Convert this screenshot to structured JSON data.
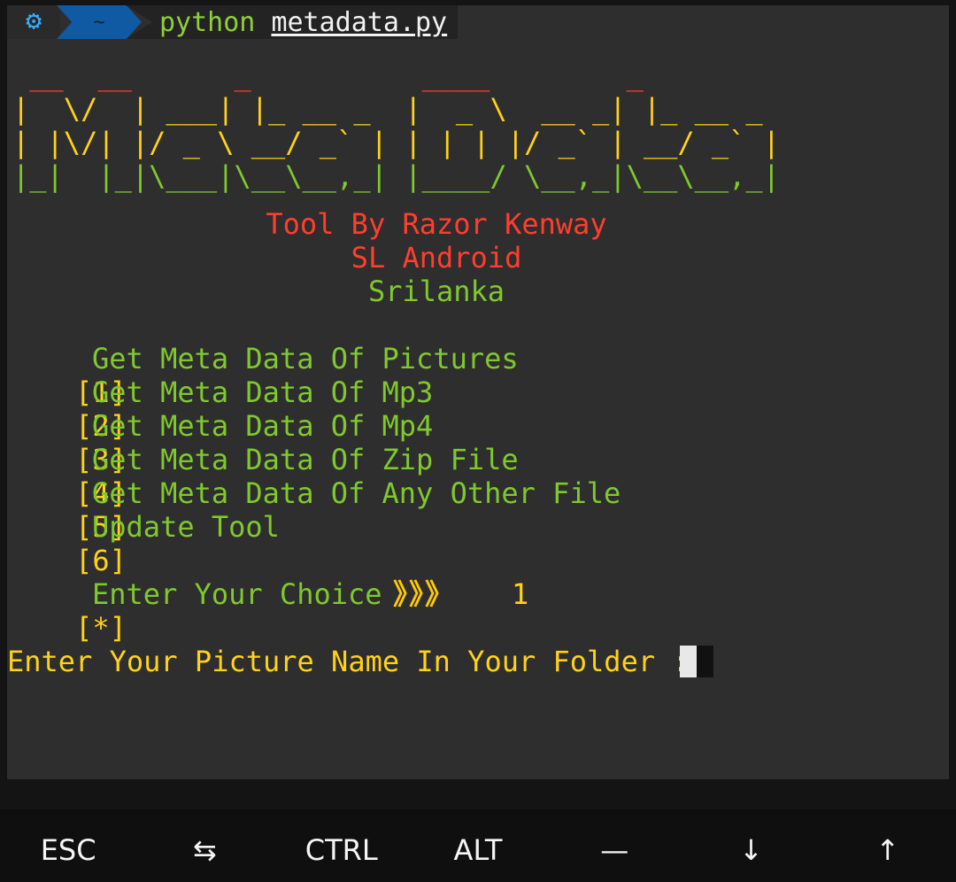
{
  "prompt": {
    "icon": "gear-icon",
    "directory": "~",
    "command": "python",
    "argument": "metadata.py"
  },
  "banner": {
    "ascii_text": "Meta Data",
    "colors": {
      "top": "#ff3e2e",
      "middle": "#ffd21a",
      "bottom": "#7fc92d"
    }
  },
  "credits": {
    "line1": "Tool By Razor Kenway",
    "line2": "SL Android",
    "line3": "Srilanka"
  },
  "menu": [
    {
      "num": "[1]",
      "label": "Get Meta Data Of Pictures"
    },
    {
      "num": "[2]",
      "label": "Get Meta Data Of Mp3"
    },
    {
      "num": "[3]",
      "label": "Get Meta Data Of Mp4"
    },
    {
      "num": "[4]",
      "label": "Get Meta Data Of Zip File"
    },
    {
      "num": "[5]",
      "label": "Get Meta Data Of Any Other File"
    },
    {
      "num": "[6]",
      "label": "Update Tool"
    }
  ],
  "choice": {
    "marker": "[*]",
    "label": "Enter Your Choice",
    "arrows": "》》》",
    "value": "1"
  },
  "input_prompt": "Enter Your Picture Name In Your Folder :",
  "extra_keys": [
    {
      "label": "ESC",
      "name": "esc-key"
    },
    {
      "label": "⇆",
      "name": "tab-key"
    },
    {
      "label": "CTRL",
      "name": "ctrl-key"
    },
    {
      "label": "ALT",
      "name": "alt-key"
    },
    {
      "label": "—",
      "name": "dash-key"
    },
    {
      "label": "↓",
      "name": "down-arrow-key"
    },
    {
      "label": "↑",
      "name": "up-arrow-key"
    }
  ]
}
